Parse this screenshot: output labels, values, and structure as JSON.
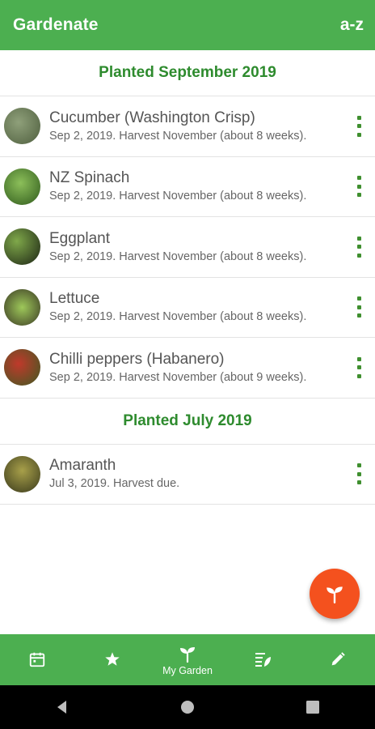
{
  "appbar": {
    "title": "Gardenate",
    "sort_label": "a-z"
  },
  "sections": [
    {
      "header": "Planted September 2019",
      "items": [
        {
          "name": "Cucumber (Washington Crisp)",
          "detail": "Sep 2, 2019. Harvest November (about 8 weeks).",
          "image_color": "#6b7b5a"
        },
        {
          "name": "NZ Spinach",
          "detail": "Sep 2, 2019. Harvest November (about 8 weeks).",
          "image_color": "#4f7a2e"
        },
        {
          "name": "Eggplant",
          "detail": "Sep 2, 2019. Harvest November (about 8 weeks).",
          "image_color": "#2f3b22"
        },
        {
          "name": "Lettuce",
          "detail": "Sep 2, 2019. Harvest November (about 8 weeks).",
          "image_color": "#5a6b3a"
        },
        {
          "name": "Chilli peppers (Habanero)",
          "detail": "Sep 2, 2019. Harvest November (about 9 weeks).",
          "image_color": "#7a3a22"
        }
      ]
    },
    {
      "header": "Planted July 2019",
      "items": [
        {
          "name": "Amaranth",
          "detail": "Jul 3, 2019. Harvest due.",
          "image_color": "#5a5a2e"
        }
      ]
    }
  ],
  "bottom_nav": [
    {
      "icon": "calendar-icon",
      "label": ""
    },
    {
      "icon": "star-icon",
      "label": ""
    },
    {
      "icon": "sprout-icon",
      "label": "My Garden",
      "active": true
    },
    {
      "icon": "notes-icon",
      "label": ""
    },
    {
      "icon": "pencil-icon",
      "label": ""
    }
  ],
  "fab": {
    "icon": "sprout-icon"
  },
  "colors": {
    "primary": "#4caf50",
    "section_header": "#2e8b2e",
    "fab": "#f4511e",
    "kebab": "#3f8f2f"
  }
}
